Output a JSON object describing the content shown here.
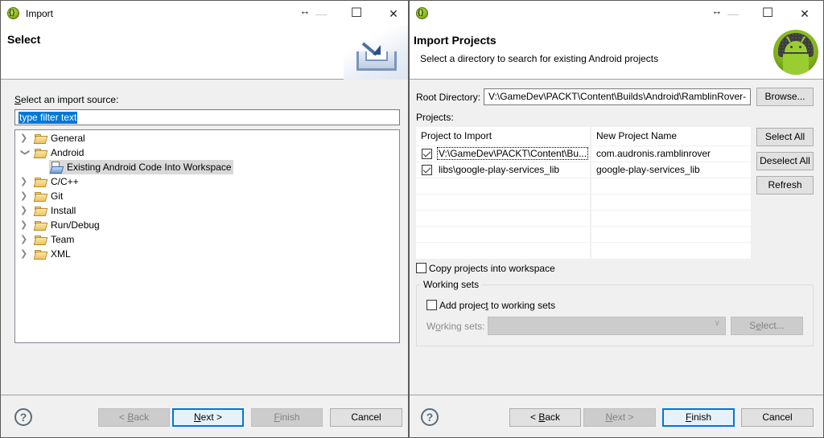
{
  "left_window": {
    "title": "Import",
    "header": {
      "title": "Select",
      "icon": "import-wizard-icon"
    },
    "source_label": "Select an import source:",
    "source_label_mnemonic": "S",
    "filter": {
      "value": "type filter text",
      "selected": true
    },
    "tree": [
      {
        "label": "General",
        "expanded": false,
        "icon": "folder-icon"
      },
      {
        "label": "Android",
        "expanded": true,
        "icon": "folder-icon",
        "children": [
          {
            "label": "Existing Android Code Into Workspace",
            "selected": true,
            "icon": "android-project-icon"
          }
        ]
      },
      {
        "label": "C/C++",
        "expanded": false,
        "icon": "folder-icon"
      },
      {
        "label": "Git",
        "expanded": false,
        "icon": "folder-icon"
      },
      {
        "label": "Install",
        "expanded": false,
        "icon": "folder-icon"
      },
      {
        "label": "Run/Debug",
        "expanded": false,
        "icon": "folder-icon"
      },
      {
        "label": "Team",
        "expanded": false,
        "icon": "folder-icon"
      },
      {
        "label": "XML",
        "expanded": false,
        "icon": "folder-icon"
      }
    ],
    "buttons": {
      "back": {
        "prefix": "< ",
        "mnemonic": "B",
        "rest": "ack",
        "enabled": false
      },
      "next": {
        "mnemonic": "N",
        "rest": "ext >",
        "enabled": true,
        "default": true
      },
      "finish": {
        "mnemonic": "F",
        "rest": "inish",
        "enabled": false
      },
      "cancel": {
        "label": "Cancel",
        "enabled": true
      }
    }
  },
  "right_window": {
    "title": "",
    "header": {
      "title": "Import Projects",
      "subtitle": "Select a directory to search for existing Android projects",
      "icon": "android-logo-icon"
    },
    "root_directory": {
      "label": "Root Directory:",
      "value": "V:\\GameDev\\PACKT\\Content\\Builds\\Android\\RamblinRover-",
      "browse_label": "Browse..."
    },
    "projects_label": "Projects:",
    "table": {
      "columns": [
        "Project to Import",
        "New Project Name"
      ],
      "rows": [
        {
          "checked": true,
          "project": "V:\\GameDev\\PACKT\\Content\\Bu...",
          "name": "com.audronis.ramblinrover"
        },
        {
          "checked": true,
          "project": "libs\\google-play-services_lib",
          "name": "google-play-services_lib"
        }
      ]
    },
    "side_buttons": {
      "select_all": "Select All",
      "deselect_all": "Deselect All",
      "refresh": "Refresh"
    },
    "copy_projects": {
      "label": "Copy projects into workspace",
      "checked": false
    },
    "working_sets": {
      "group_title": "Working sets",
      "add_checkbox": {
        "before": "Add projec",
        "mnemonic": "t",
        "after": " to working sets",
        "checked": false
      },
      "label_before": "W",
      "label_mnemonic": "o",
      "label_after": "rking sets:",
      "combo_value": "",
      "select_button": {
        "before": "S",
        "mnemonic": "e",
        "after": "lect...",
        "enabled": false
      }
    },
    "buttons": {
      "back": {
        "prefix": "< ",
        "mnemonic": "B",
        "rest": "ack",
        "enabled": true
      },
      "next": {
        "mnemonic": "N",
        "rest": "ext >",
        "enabled": false
      },
      "finish": {
        "mnemonic": "F",
        "rest": "inish",
        "enabled": true,
        "default": true
      },
      "cancel": {
        "label": "Cancel",
        "enabled": true
      }
    }
  },
  "titlebar_controls": {
    "resize": "↔",
    "minimize": "—",
    "maximize": "☐",
    "close": "✕"
  },
  "help_glyph": "?",
  "colors": {
    "accent": "#0078d7",
    "window_bg": "#f0f0f0",
    "disabled_button": "#cccccc"
  }
}
